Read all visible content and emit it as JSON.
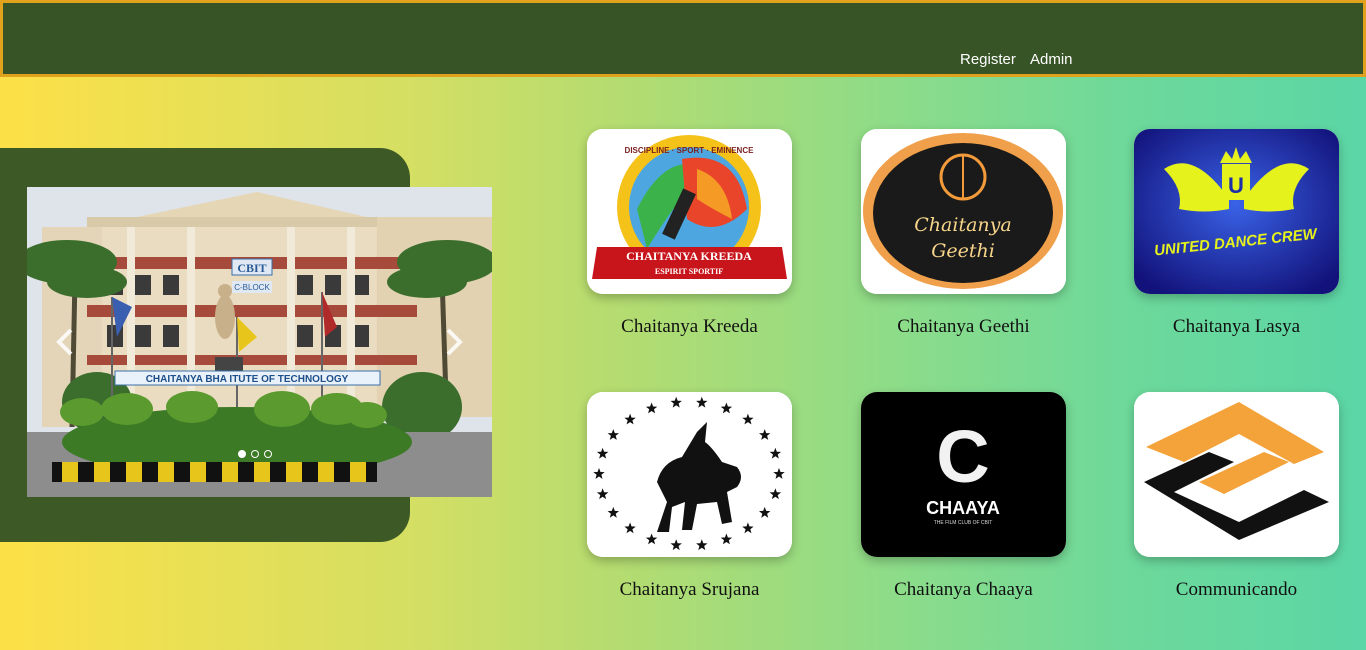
{
  "nav": {
    "register": "Register",
    "admin": "Admin"
  },
  "carousel": {
    "slide_count": 3,
    "active_slide": 1,
    "sign_cbit": "CBIT",
    "sign_block": "C-BLOCK",
    "sign_institute": "CHAITANYA BHA      ITUTE OF TECHNOLOGY"
  },
  "clubs": [
    {
      "name": "Chaitanya Kreeda",
      "logo_arc": "DISCIPLINE · SPORT · EMINENCE",
      "logo_banner": "CHAITANYA KREEDA",
      "logo_sub": "ESPIRIT SPORTIF"
    },
    {
      "name": "Chaitanya Geethi",
      "logo_line1": "Chaitanya",
      "logo_line2": "Geethi"
    },
    {
      "name": "Chaitanya Lasya",
      "logo_text": "UNITED DANCE CREW",
      "logo_mark": "U"
    },
    {
      "name": "Chaitanya Srujana"
    },
    {
      "name": "Chaitanya Chaaya",
      "logo_mark": "C",
      "logo_title": "CHAAYA",
      "logo_sub": "THE FILM CLUB OF CBIT"
    },
    {
      "name": "Communicando"
    }
  ],
  "colors": {
    "navbar": "#375426",
    "navbar_border": "#e0a21c",
    "panel": "#3d5a26"
  }
}
